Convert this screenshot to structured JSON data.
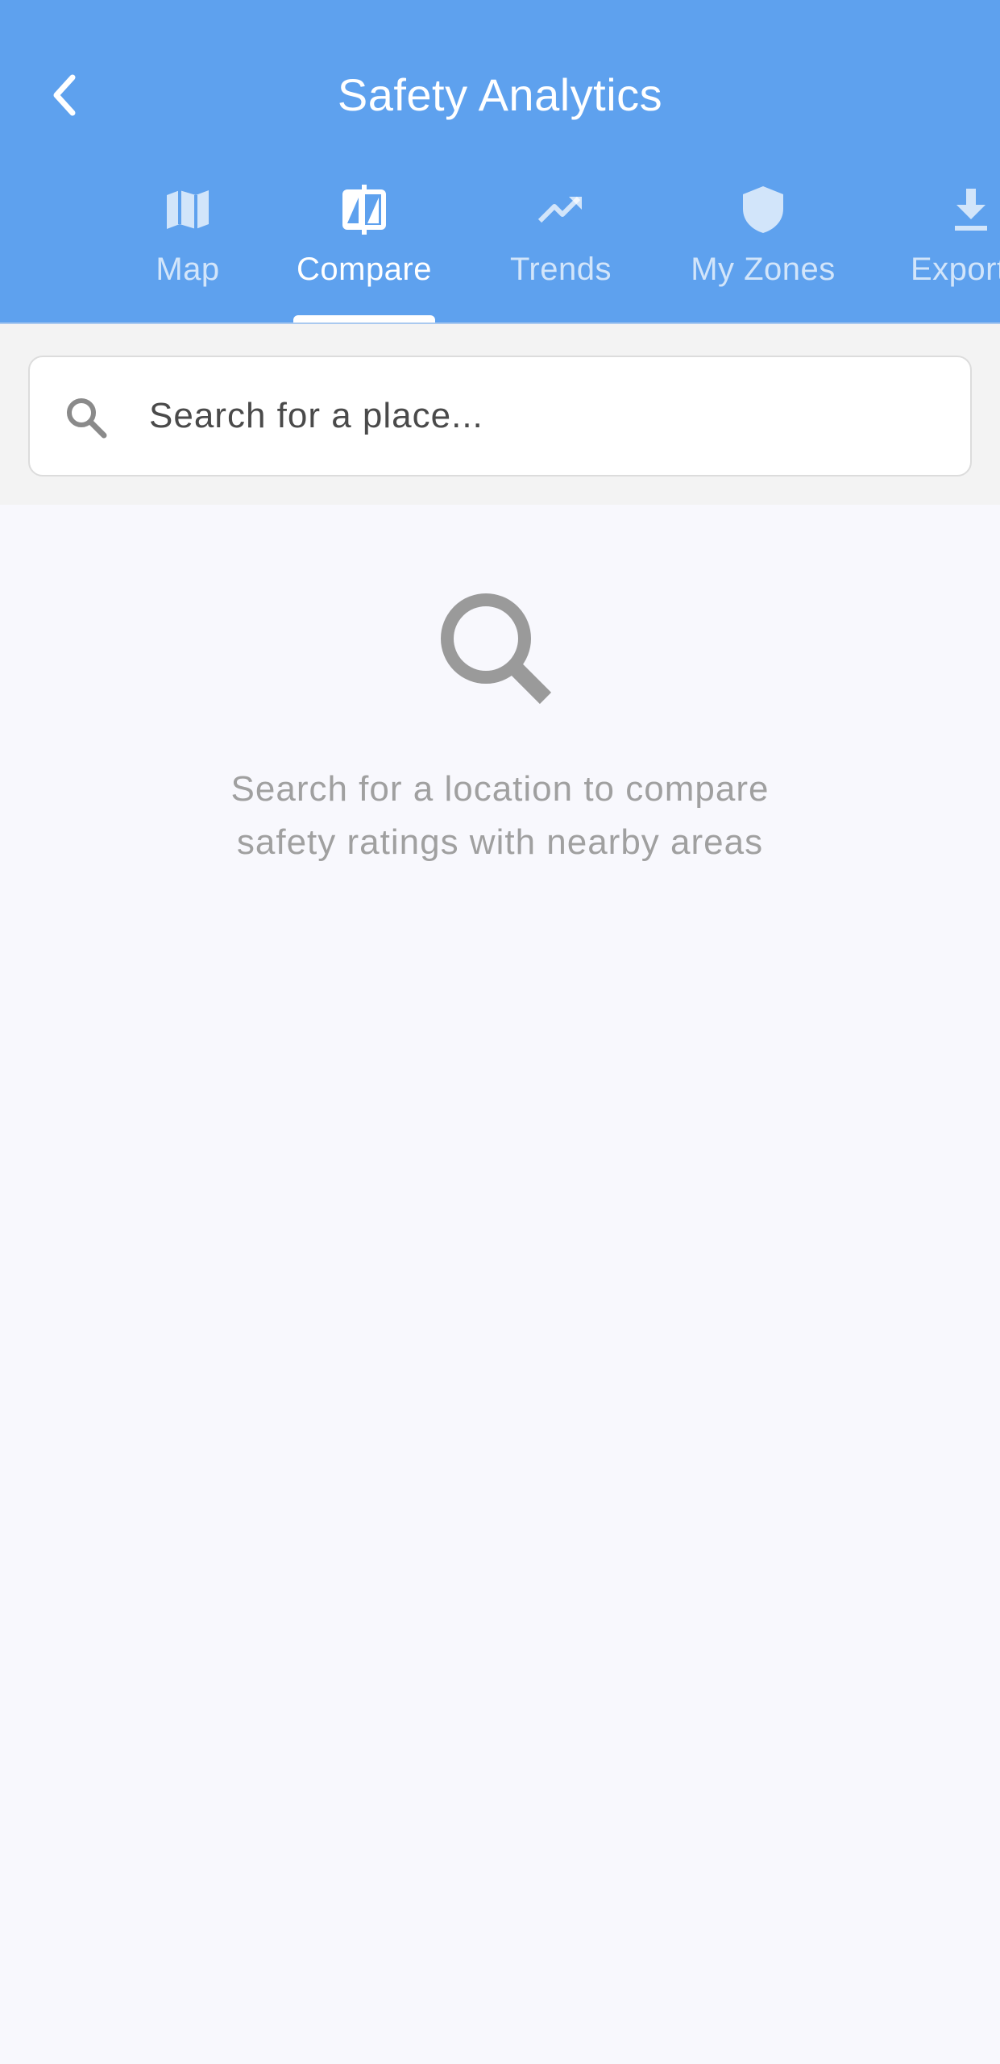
{
  "header": {
    "title": "Safety Analytics",
    "background_color": "#5ea1ee",
    "back_icon": "chevron-left-icon"
  },
  "tabs": [
    {
      "label": "Map",
      "icon": "map-icon",
      "active": false
    },
    {
      "label": "Compare",
      "icon": "compare-icon",
      "active": true
    },
    {
      "label": "Trends",
      "icon": "trending-up-icon",
      "active": false
    },
    {
      "label": "My Zones",
      "icon": "shield-icon",
      "active": false
    },
    {
      "label": "Export",
      "icon": "download-icon",
      "active": false
    }
  ],
  "search": {
    "placeholder": "Search for a place...",
    "value": "",
    "icon": "search-icon"
  },
  "empty_state": {
    "icon": "search-icon",
    "line1": "Search for a location to compare",
    "line2": "safety ratings with nearby areas"
  }
}
